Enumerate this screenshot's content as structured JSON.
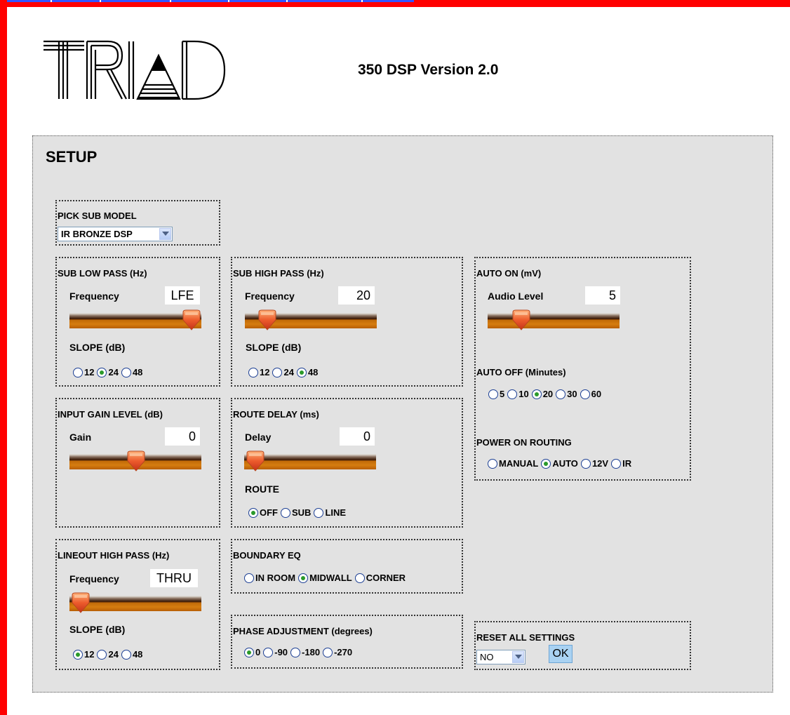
{
  "header": {
    "logo_text": "TRIAD",
    "title": "350 DSP Version 2.0"
  },
  "setup": {
    "title": "SETUP",
    "sub_model": {
      "title": "PICK SUB MODEL",
      "selected": "IR BRONZE DSP"
    },
    "sub_low_pass": {
      "title": "SUB LOW PASS (Hz)",
      "freq_label": "Frequency",
      "freq_value": "LFE",
      "slider_level": 1.0,
      "slope_label": "SLOPE (dB)",
      "slopes": [
        {
          "label": "12",
          "checked": false
        },
        {
          "label": "24",
          "checked": true
        },
        {
          "label": "48",
          "checked": false
        }
      ]
    },
    "sub_high_pass": {
      "title": "SUB HIGH PASS (Hz)",
      "freq_label": "Frequency",
      "freq_value": "20",
      "slider_level": 0.1,
      "slope_label": "SLOPE (dB)",
      "slopes": [
        {
          "label": "12",
          "checked": false
        },
        {
          "label": "24",
          "checked": false
        },
        {
          "label": "48",
          "checked": true
        }
      ]
    },
    "input_gain": {
      "title": "INPUT GAIN LEVEL (dB)",
      "gain_label": "Gain",
      "gain_value": "0",
      "slider_level": 0.5
    },
    "route_delay": {
      "title": "ROUTE DELAY (ms)",
      "delay_label": "Delay",
      "delay_value": "0",
      "slider_level": 0.0,
      "route_label": "ROUTE",
      "routes": [
        {
          "label": "OFF",
          "checked": true
        },
        {
          "label": "SUB",
          "checked": false
        },
        {
          "label": "LINE",
          "checked": false
        }
      ]
    },
    "lineout_high_pass": {
      "title": "LINEOUT HIGH PASS (Hz)",
      "freq_label": "Frequency",
      "freq_value": "THRU",
      "slider_level": 0.0,
      "slope_label": "SLOPE (dB)",
      "slopes": [
        {
          "label": "12",
          "checked": true
        },
        {
          "label": "24",
          "checked": false
        },
        {
          "label": "48",
          "checked": false
        }
      ]
    },
    "boundary_eq": {
      "title": "BOUNDARY EQ",
      "options": [
        {
          "label": "IN ROOM",
          "checked": false
        },
        {
          "label": "MIDWALL",
          "checked": true
        },
        {
          "label": "CORNER",
          "checked": false
        }
      ]
    },
    "phase": {
      "title": "PHASE ADJUSTMENT (degrees)",
      "options": [
        {
          "label": "0",
          "checked": true
        },
        {
          "label": "-90",
          "checked": false
        },
        {
          "label": "-180",
          "checked": false
        },
        {
          "label": "-270",
          "checked": false
        }
      ]
    },
    "auto_on": {
      "title": "AUTO ON (mV)",
      "level_label": "Audio Level",
      "level_value": "5",
      "slider_level": 0.2
    },
    "auto_off": {
      "title": "AUTO OFF (Minutes)",
      "options": [
        {
          "label": "5",
          "checked": false
        },
        {
          "label": "10",
          "checked": false
        },
        {
          "label": "20",
          "checked": true
        },
        {
          "label": "30",
          "checked": false
        },
        {
          "label": "60",
          "checked": false
        }
      ]
    },
    "power_on_routing": {
      "title": "POWER ON ROUTING",
      "options": [
        {
          "label": "MANUAL",
          "checked": false
        },
        {
          "label": "AUTO",
          "checked": true
        },
        {
          "label": "12V",
          "checked": false
        },
        {
          "label": "IR",
          "checked": false
        }
      ]
    },
    "reset": {
      "title": "RESET ALL SETTINGS",
      "selected": "NO",
      "ok_label": "OK"
    }
  },
  "colors": {
    "frame": "#ff0000",
    "panel": "#e2e2e2",
    "slider_track": "#c06a08",
    "thumb": "#e8502a",
    "radio_dot": "#2a9a2a"
  }
}
